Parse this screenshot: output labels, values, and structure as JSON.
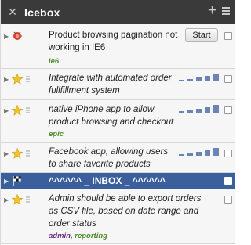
{
  "header": {
    "title": "Icebox"
  },
  "stories": [
    {
      "type": "bug",
      "title": "Product browsing pagination not working in IE6",
      "labels": [
        "ie6"
      ],
      "action": "Start"
    },
    {
      "type": "feature",
      "title": "Integrate with automated order fullfillment system",
      "labels": []
    },
    {
      "type": "feature",
      "title": "native iPhone app to allow product browsing and checkout",
      "labels": [
        "epic"
      ]
    },
    {
      "type": "feature",
      "title": "Facebook app, allowing users to share favorite products",
      "labels": []
    },
    {
      "type": "release",
      "title": "^^^^^^ _ INBOX _ ^^^^^^",
      "labels": []
    },
    {
      "type": "feature",
      "title": "Admin should be able to export orders as CSV file, based on date range and order status",
      "labels": [
        "admin",
        "reporting"
      ]
    }
  ],
  "colors": {
    "header_bg": "#3a3a3a",
    "story_bg": "#f6f6f6",
    "iteration_bg": "#3b5f9c",
    "estimate_bar": "#6a84b6",
    "label_green": "#4a8a2a",
    "label_purple": "#6a2a8a"
  }
}
